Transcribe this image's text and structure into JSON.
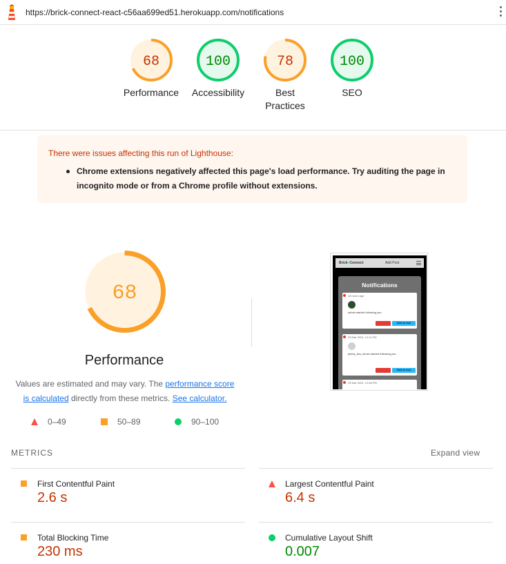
{
  "browser": {
    "url": "https://brick-connect-react-c56aa699ed51.herokuapp.com/notifications"
  },
  "colors": {
    "fail": "#c33300",
    "average": "#fa9f28",
    "pass": "#0cce6b",
    "pass_text": "#008800"
  },
  "categories": [
    {
      "label": "Performance",
      "score": "68",
      "level": "average"
    },
    {
      "label": "Accessibility",
      "score": "100",
      "level": "pass"
    },
    {
      "label": "Best Practices",
      "score": "78",
      "level": "average"
    },
    {
      "label": "SEO",
      "score": "100",
      "level": "pass"
    }
  ],
  "warning": {
    "title": "There were issues affecting this run of Lighthouse:",
    "item_line1": "Chrome extensions negatively affected this page's load performance. Try auditing the page in",
    "item_line2": "incognito mode or from a Chrome profile without extensions."
  },
  "performance": {
    "score": "68",
    "title": "Performance",
    "desc_prefix": "Values are estimated and may vary. The ",
    "desc_link1_a": "performance score",
    "desc_link1_b": "is calculated",
    "desc_middle": " directly from these metrics. ",
    "desc_link2": "See calculator."
  },
  "legend": [
    {
      "range": "0–49",
      "shape": "triangle"
    },
    {
      "range": "50–89",
      "shape": "square"
    },
    {
      "range": "90–100",
      "shape": "circle"
    }
  ],
  "thumbnail": {
    "brand_a": "Brick",
    "brand_b": "Connect",
    "add_post": "Add Post",
    "heading": "Notifications",
    "card1_time": "16 hours ago",
    "card1_msg": "admin started following you.",
    "card2_time": "25 Mar 2024, 12:11 PM",
    "card2_msg": "jimmy_two_shoes started following you.",
    "card3_time": "25 Mar 2024, 12:08 PM",
    "mark_read": "Mark as read"
  },
  "metrics": {
    "heading": "METRICS",
    "expand": "Expand view",
    "items": [
      {
        "label": "First Contentful Paint",
        "value": "2.6 s",
        "level": "average"
      },
      {
        "label": "Largest Contentful Paint",
        "value": "6.4 s",
        "level": "fail"
      },
      {
        "label": "Total Blocking Time",
        "value": "230 ms",
        "level": "average"
      },
      {
        "label": "Cumulative Layout Shift",
        "value": "0.007",
        "level": "pass"
      }
    ]
  }
}
